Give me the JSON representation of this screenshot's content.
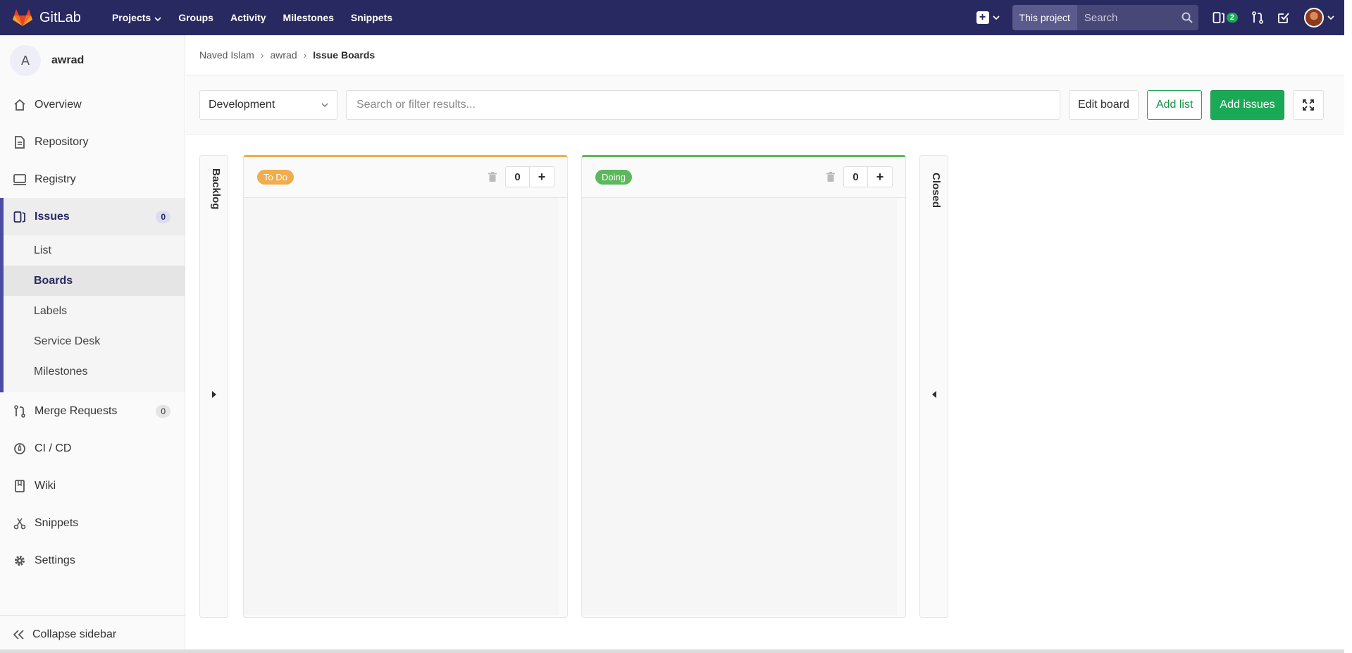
{
  "topbar": {
    "brand": "GitLab",
    "nav": [
      {
        "label": "Projects",
        "caret": true
      },
      {
        "label": "Groups"
      },
      {
        "label": "Activity"
      },
      {
        "label": "Milestones"
      },
      {
        "label": "Snippets"
      }
    ],
    "search_scope": "This project",
    "search_placeholder": "Search",
    "issues_badge": "2"
  },
  "sidebar": {
    "project_initial": "A",
    "project_name": "awrad",
    "items": {
      "overview": "Overview",
      "repository": "Repository",
      "registry": "Registry",
      "issues": "Issues",
      "issues_count": "0",
      "merge_requests": "Merge Requests",
      "merge_requests_count": "0",
      "cicd": "CI / CD",
      "wiki": "Wiki",
      "snippets": "Snippets",
      "settings": "Settings"
    },
    "issues_sub": {
      "list": "List",
      "boards": "Boards",
      "labels": "Labels",
      "service_desk": "Service Desk",
      "milestones": "Milestones"
    },
    "collapse": "Collapse sidebar"
  },
  "breadcrumb": {
    "owner": "Naved Islam",
    "project": "awrad",
    "current": "Issue Boards"
  },
  "filters": {
    "board": "Development",
    "search_placeholder": "Search or filter results...",
    "edit_board": "Edit board",
    "add_list": "Add list",
    "add_issues": "Add issues"
  },
  "board": {
    "backlog": "Backlog",
    "closed": "Closed",
    "lists": [
      {
        "label": "To Do",
        "color": "#f0ad4e",
        "count": "0"
      },
      {
        "label": "Doing",
        "color": "#5cb85c",
        "count": "0"
      }
    ]
  }
}
